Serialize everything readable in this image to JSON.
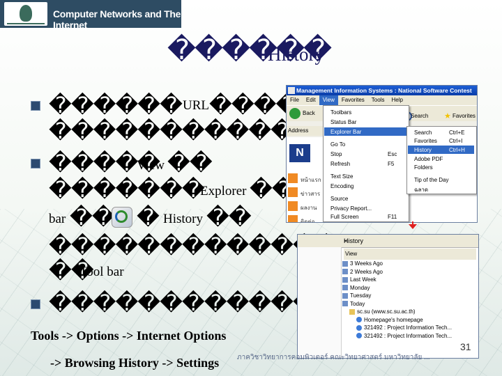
{
  "header": {
    "title": "Computer Networks and The Internet"
  },
  "slide": {
    "title_glyphs": "������",
    "title_latin": "History",
    "bullets": [
      {
        "line1": "������",
        "line1_latin": "URL",
        "line1_tail": "�����",
        "line2": "�����������"
      },
      {
        "line1": "�����",
        "line1_latin": "View",
        "line1_tail": "��",
        "line2": "�������",
        "line2_latin": "Explorer",
        "line2_tail": "��",
        "line3_latin_a": "bar",
        "line3_g1": "��",
        "line3_g2": "�",
        "line3_latin_b": "History",
        "line3_g3": "��",
        "line4": "�������������",
        "line5": "��",
        "line5_latin": "Tool bar"
      },
      {
        "line1": "��������������"
      }
    ],
    "instruction_line1": "Tools -> Options -> Internet Options",
    "instruction_line2": "-> Browsing History -> Settings",
    "page_number": "31",
    "footer": "ภาควิชาวิทยาการคอมพิวเตอร์ คณะวิทยาศาสตร์ มหาวิทยาลัย ..."
  },
  "shot1": {
    "title": "Management Information Systems : National Software Contest",
    "menubar": [
      "File",
      "Edit",
      "View",
      "Favorites",
      "Tools",
      "Help"
    ],
    "back_label": "Back",
    "search_label": "Search",
    "favorites_label": "Favorites",
    "address_label": "Address",
    "side_items": [
      "หน้าแรก",
      "ข่าวสาร",
      "ผลงาน",
      "ติดต่อ"
    ],
    "view_menu": [
      {
        "label": "Toolbars",
        "shortcut": ""
      },
      {
        "label": "Status Bar",
        "shortcut": ""
      },
      {
        "label": "Explorer Bar",
        "shortcut": ""
      },
      {
        "label": "Go To",
        "shortcut": ""
      },
      {
        "label": "Stop",
        "shortcut": "Esc"
      },
      {
        "label": "Refresh",
        "shortcut": "F5"
      },
      {
        "label": "Text Size",
        "shortcut": ""
      },
      {
        "label": "Encoding",
        "shortcut": ""
      },
      {
        "label": "Source",
        "shortcut": ""
      },
      {
        "label": "Privacy Report...",
        "shortcut": ""
      },
      {
        "label": "Full Screen",
        "shortcut": "F11"
      }
    ],
    "explorer_menu": [
      {
        "label": "Search",
        "shortcut": "Ctrl+E"
      },
      {
        "label": "Favorites",
        "shortcut": "Ctrl+I"
      },
      {
        "label": "History",
        "shortcut": "Ctrl+H"
      },
      {
        "label": "Adobe PDF",
        "shortcut": ""
      },
      {
        "label": "Folders",
        "shortcut": ""
      },
      {
        "label": "Tip of the Day",
        "shortcut": ""
      },
      {
        "label": "ฉลาด",
        "shortcut": ""
      }
    ]
  },
  "shot2": {
    "title": "History",
    "view_label": "View",
    "items": [
      "3 Weeks Ago",
      "2 Weeks Ago",
      "Last Week",
      "Monday",
      "Tuesday",
      "Today",
      "sc.su (www.sc.su.ac.th)",
      "Homepage's homepage",
      "321492 : Project Information Tech...",
      "321492 : Project Information Tech..."
    ]
  },
  "colors": {
    "header_bg": "#2e4c63",
    "title_color": "#1a1a60",
    "accent_red": "#e02020",
    "xp_blue": "#1d5fd6"
  }
}
